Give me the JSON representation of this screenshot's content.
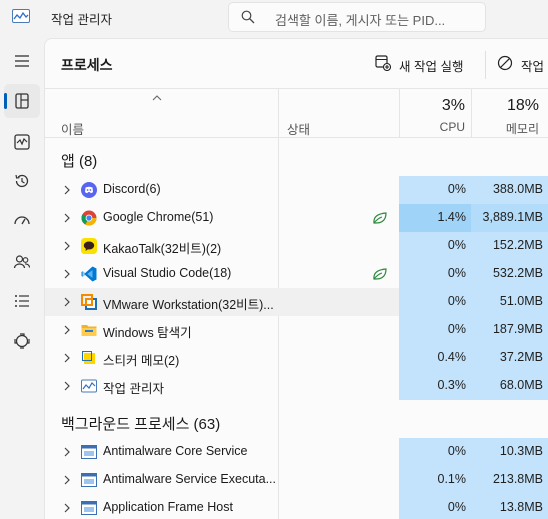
{
  "app": {
    "title": "작업 관리자",
    "search_placeholder": "검색할 이름, 게시자 또는 PID..."
  },
  "nav": {
    "items": [
      "menu-icon",
      "processes-icon",
      "performance-icon",
      "app-history-icon",
      "startup-apps-icon",
      "users-icon",
      "details-icon",
      "services-icon"
    ],
    "active": "processes-icon"
  },
  "page": {
    "title": "프로세스",
    "run_new_task": "새 작업 실행",
    "end_task": "작업"
  },
  "columns": {
    "name": "이름",
    "status": "상태",
    "cpu_pct": "3%",
    "cpu": "CPU",
    "mem_pct": "18%",
    "mem": "메모리"
  },
  "groups": {
    "apps": "앱 (8)",
    "background": "백그라운드 프로세스 (63)"
  },
  "apps": [
    {
      "name": "Discord(6)",
      "cpu": "0%",
      "mem": "388.0MB",
      "icon": "discord-icon",
      "eco": false
    },
    {
      "name": "Google Chrome(51)",
      "cpu": "1.4%",
      "mem": "3,889.1MB",
      "icon": "chrome-icon",
      "eco": true
    },
    {
      "name": "KakaoTalk(32비트)(2)",
      "cpu": "0%",
      "mem": "152.2MB",
      "icon": "kakaotalk-icon",
      "eco": false
    },
    {
      "name": "Visual Studio Code(18)",
      "cpu": "0%",
      "mem": "532.2MB",
      "icon": "vscode-icon",
      "eco": true
    },
    {
      "name": "VMware Workstation(32비트)...",
      "cpu": "0%",
      "mem": "51.0MB",
      "icon": "vmware-icon",
      "eco": false
    },
    {
      "name": "Windows 탐색기",
      "cpu": "0%",
      "mem": "187.9MB",
      "icon": "folder-icon",
      "eco": false
    },
    {
      "name": "스티커 메모(2)",
      "cpu": "0.4%",
      "mem": "37.2MB",
      "icon": "sticky-notes-icon",
      "eco": false
    },
    {
      "name": "작업 관리자",
      "cpu": "0.3%",
      "mem": "68.0MB",
      "icon": "task-manager-icon",
      "eco": false
    }
  ],
  "background": [
    {
      "name": "Antimalware Core Service",
      "cpu": "0%",
      "mem": "10.3MB",
      "icon": "service-icon"
    },
    {
      "name": "Antimalware Service Executa...",
      "cpu": "0.1%",
      "mem": "213.8MB",
      "icon": "service-icon"
    },
    {
      "name": "Application Frame Host",
      "cpu": "0%",
      "mem": "13.8MB",
      "icon": "service-icon"
    }
  ]
}
